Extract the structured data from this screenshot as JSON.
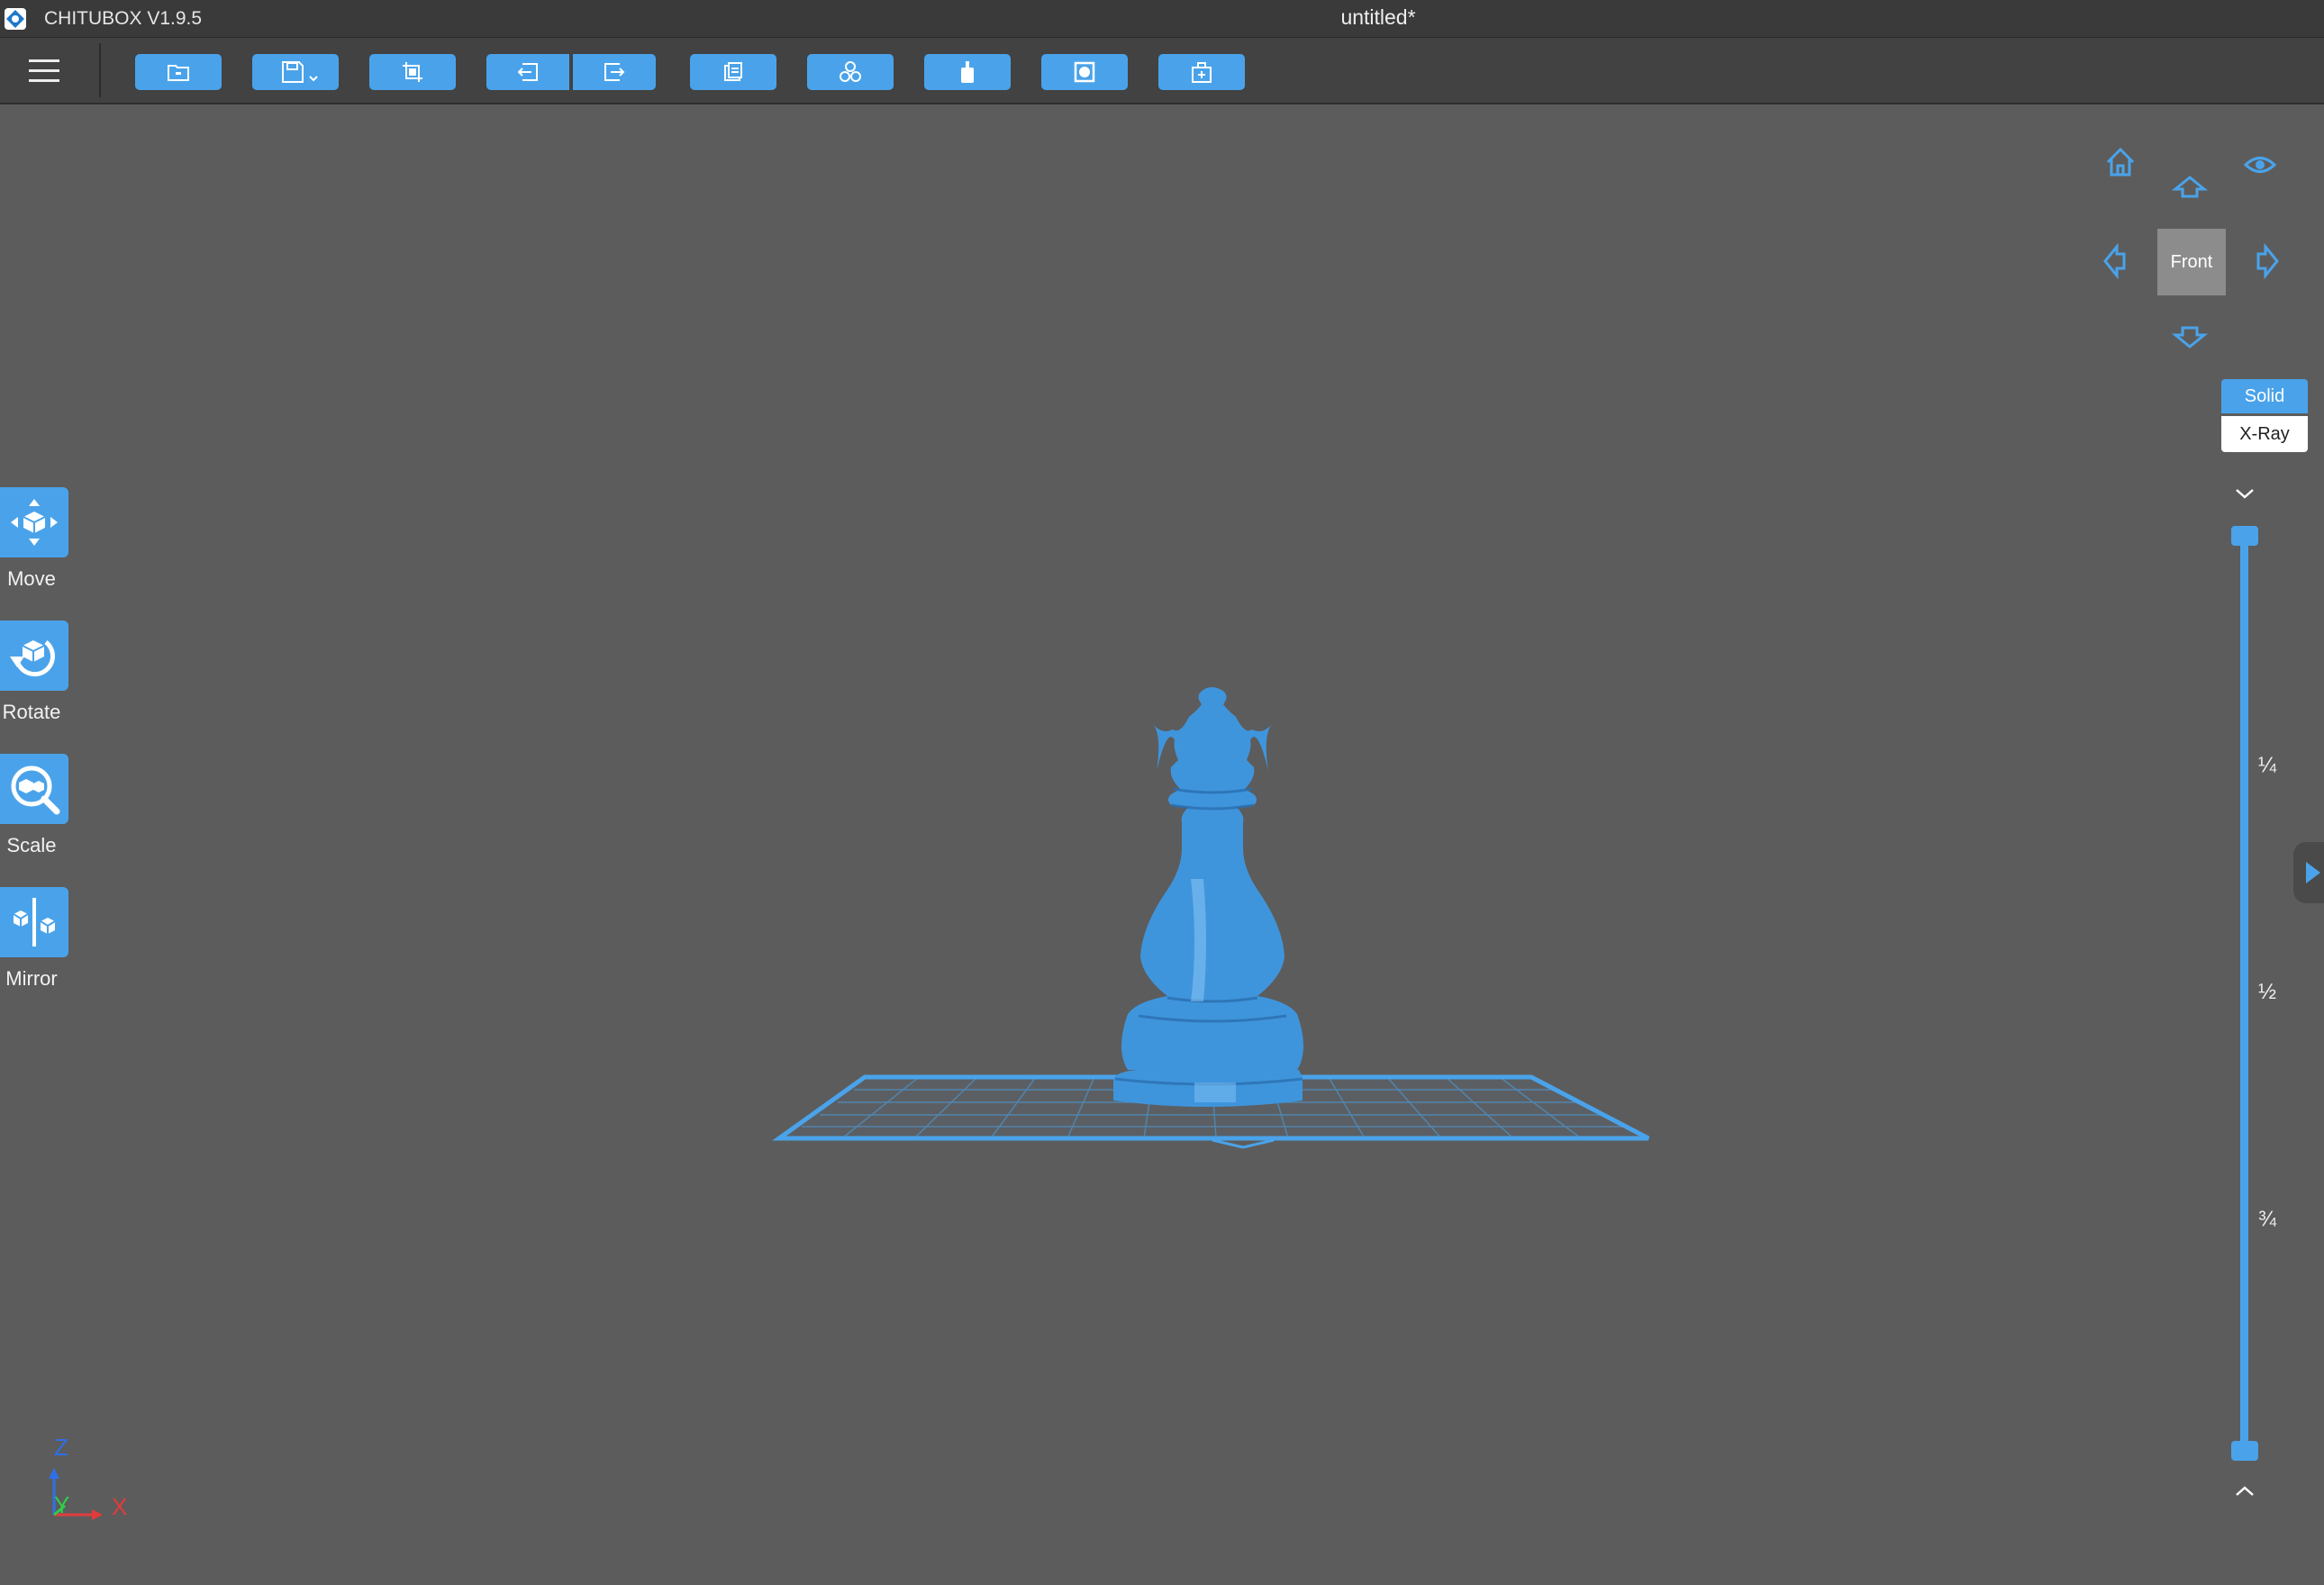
{
  "window": {
    "app_name": "CHITUBOX V1.9.5",
    "document_title": "untitled*"
  },
  "toolbar": {
    "buttons": [
      {
        "name": "open-file",
        "icon": "folder-icon"
      },
      {
        "name": "save",
        "icon": "save-icon",
        "has_dropdown": true
      },
      {
        "name": "auto-layout",
        "icon": "crop-frame-icon"
      },
      {
        "name": "undo",
        "icon": "arrow-left-icon"
      },
      {
        "name": "redo",
        "icon": "arrow-right-icon"
      },
      {
        "name": "copy",
        "icon": "copy-icon"
      },
      {
        "name": "arrange",
        "icon": "cubes-icon"
      },
      {
        "name": "supports",
        "icon": "support-icon"
      },
      {
        "name": "hollow",
        "icon": "hollow-icon"
      },
      {
        "name": "dig-hole",
        "icon": "add-box-icon"
      }
    ]
  },
  "tools": [
    {
      "label": "Move",
      "icon": "move-icon"
    },
    {
      "label": "Rotate",
      "icon": "rotate-icon"
    },
    {
      "label": "Scale",
      "icon": "scale-icon"
    },
    {
      "label": "Mirror",
      "icon": "mirror-icon"
    }
  ],
  "view": {
    "current_view": "Front",
    "render_modes": {
      "solid": "Solid",
      "xray": "X-Ray"
    },
    "active_mode": "Solid"
  },
  "layer_slider": {
    "ticks": [
      "¼",
      "½",
      "¾"
    ],
    "top_value": 1.0,
    "bottom_value": 0.0
  },
  "axes": {
    "z": "Z",
    "y": "Y",
    "x": "X"
  },
  "colors": {
    "accent": "#4aa3ea",
    "model": "#3f95dc",
    "viewport_bg": "#5c5c5c",
    "axis_x": "#e23b3b",
    "axis_y": "#2fcc4a",
    "axis_z": "#2f6fe8"
  }
}
